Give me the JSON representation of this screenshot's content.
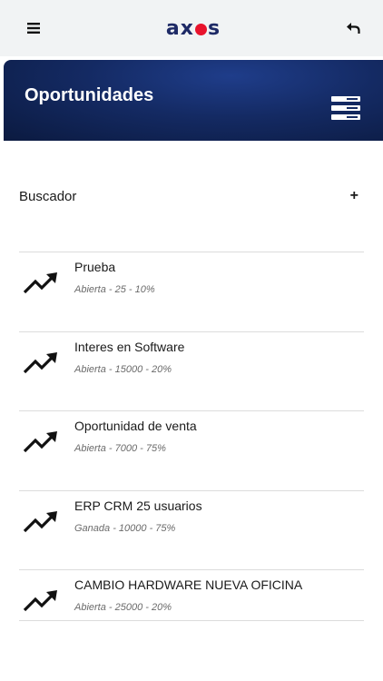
{
  "app": {
    "logo_left": "ax",
    "logo_right": "s"
  },
  "hero": {
    "title": "Oportunidades"
  },
  "search": {
    "label": "Buscador",
    "toggle": "+"
  },
  "opportunities": [
    {
      "title": "Prueba",
      "detail": "Abierta - 25 - 10%"
    },
    {
      "title": "Interes en Software",
      "detail": "Abierta - 15000 - 20%"
    },
    {
      "title": "Oportunidad de venta",
      "detail": "Abierta - 7000 - 75%"
    },
    {
      "title": "ERP CRM 25 usuarios",
      "detail": "Ganada - 10000 - 75%"
    },
    {
      "title": "CAMBIO HARDWARE NUEVA OFICINA",
      "detail": "Abierta - 25000 - 20%"
    }
  ],
  "icons": {
    "menu": "hamburger-icon",
    "back": "reply-arrow-icon",
    "list_view": "list-view-icon",
    "item": "trending-up-icon"
  },
  "colors": {
    "brand_navy": "#1e2a66",
    "brand_red": "#e8132c",
    "hero_bg": "#142a63"
  }
}
